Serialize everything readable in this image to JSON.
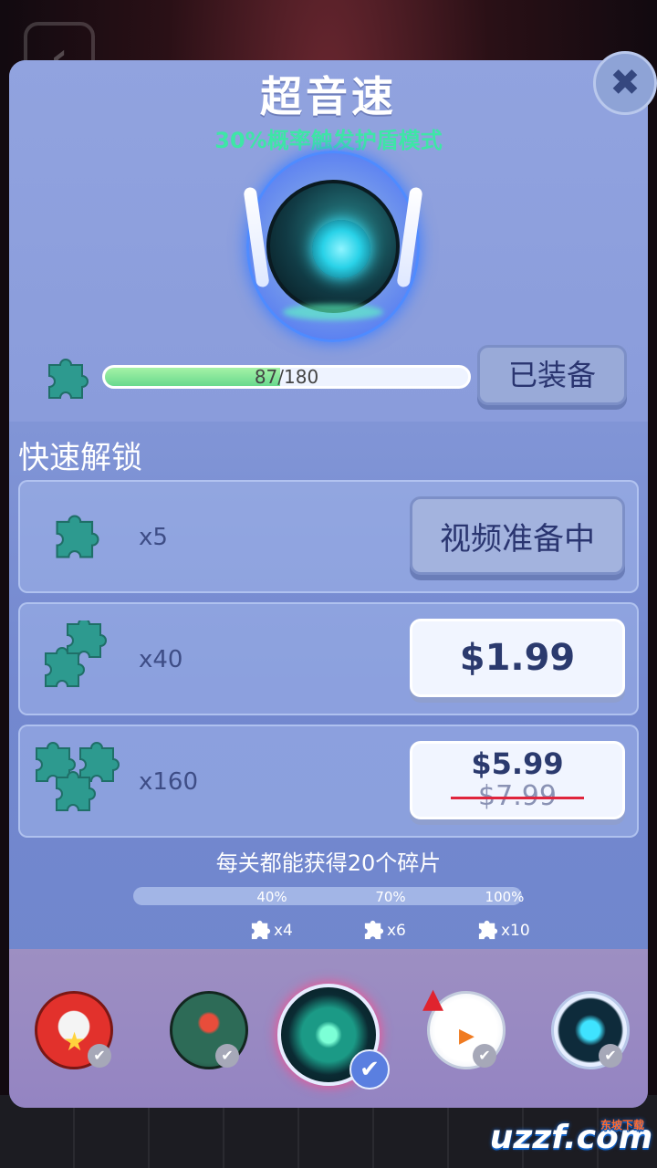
{
  "panel": {
    "title": "超音速",
    "subtitle": "30%概率触发护盾模式",
    "close_icon": "✖"
  },
  "progress": {
    "current": 87,
    "total": 180,
    "label": "87/180",
    "fraction": 0.483
  },
  "equip_button": "已装备",
  "quick_unlock": {
    "title": "快速解锁",
    "rows": [
      {
        "qty": "x5",
        "button": "视频准备中"
      },
      {
        "qty": "x40",
        "price": "$1.99"
      },
      {
        "qty": "x160",
        "price": "$5.99",
        "old_price": "$7.99"
      }
    ]
  },
  "info": {
    "text": "每关都能获得20个碎片",
    "milestones": [
      {
        "pct": "40%",
        "reward": "x4"
      },
      {
        "pct": "70%",
        "reward": "x6"
      },
      {
        "pct": "100%",
        "reward": "x10"
      }
    ]
  },
  "carousel": {
    "characters": [
      "skull-ball",
      "scarab-ball",
      "supersonic-ball",
      "snowman-ball",
      "astronaut-ball"
    ],
    "selected_check": "✔",
    "check": "✔"
  },
  "watermark": {
    "text": "uzzf.com",
    "sub": "东坡下载"
  },
  "colors": {
    "accent_green": "#3ee6a6",
    "panel_blue": "#8195d6",
    "price_strike": "#e0253d"
  }
}
